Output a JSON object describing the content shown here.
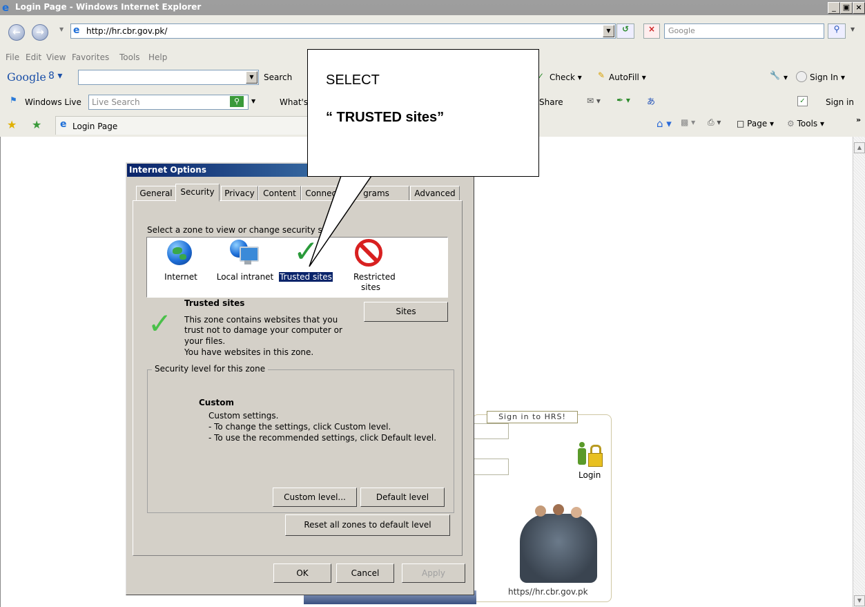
{
  "window": {
    "title": "Login Page - Windows Internet Explorer",
    "controls": [
      "_",
      "\u0000",
      "X"
    ]
  },
  "address": {
    "url": "http://hr.cbr.gov.pk/",
    "search_placeholder": "Google"
  },
  "menu": [
    "File",
    "Edit",
    "View",
    "Favorites",
    "Tools",
    "Help"
  ],
  "google_bar": {
    "brand": "Google",
    "g_label": "8",
    "search_label": "Search",
    "check_label": "Check",
    "autofill_label": "AutoFill",
    "signin_label": "Sign In"
  },
  "live_bar": {
    "brand": "Windows Live",
    "search_placeholder": "Live Search",
    "whats_label": "What's",
    "share_label": "Share",
    "signin_label": "Sign in"
  },
  "fav_bar": {
    "tab_label": "Login Page",
    "page_label": "Page",
    "tools_label": "Tools"
  },
  "callout": {
    "line1": "SELECT",
    "line2": "“ TRUSTED sites”"
  },
  "dialog": {
    "title": "Internet Options",
    "tabs": [
      "General",
      "Security",
      "Privacy",
      "Content",
      "Connect",
      "grams",
      "Advanced"
    ],
    "zone_prompt": "Select a zone to view or change security se",
    "zones": [
      {
        "label": "Internet",
        "icon": "globe-icon"
      },
      {
        "label": "Local intranet",
        "icon": "intranet-icon"
      },
      {
        "label": "Trusted sites",
        "icon": "checkmark-icon"
      },
      {
        "label": "Restricted sites",
        "icon": "restricted-icon"
      }
    ],
    "zone_title": "Trusted sites",
    "zone_desc": [
      "This zone contains websites that you",
      "trust not to damage your computer or",
      "your files.",
      "You have websites in this zone."
    ],
    "sites_button": "Sites",
    "level_group": "Security level for this zone",
    "level_title": "Custom",
    "level_desc": [
      "Custom settings.",
      "- To change the settings, click Custom level.",
      "- To use the recommended settings, click Default level."
    ],
    "custom_button": "Custom level...",
    "default_button": "Default level",
    "reset_button": "Reset all zones to default level",
    "ok_button": "OK",
    "cancel_button": "Cancel",
    "apply_button": "Apply"
  },
  "signin": {
    "title": "Sign in to HRS!",
    "login_label": "Login",
    "footer_url": "https//hr.cbr.gov.pk"
  }
}
